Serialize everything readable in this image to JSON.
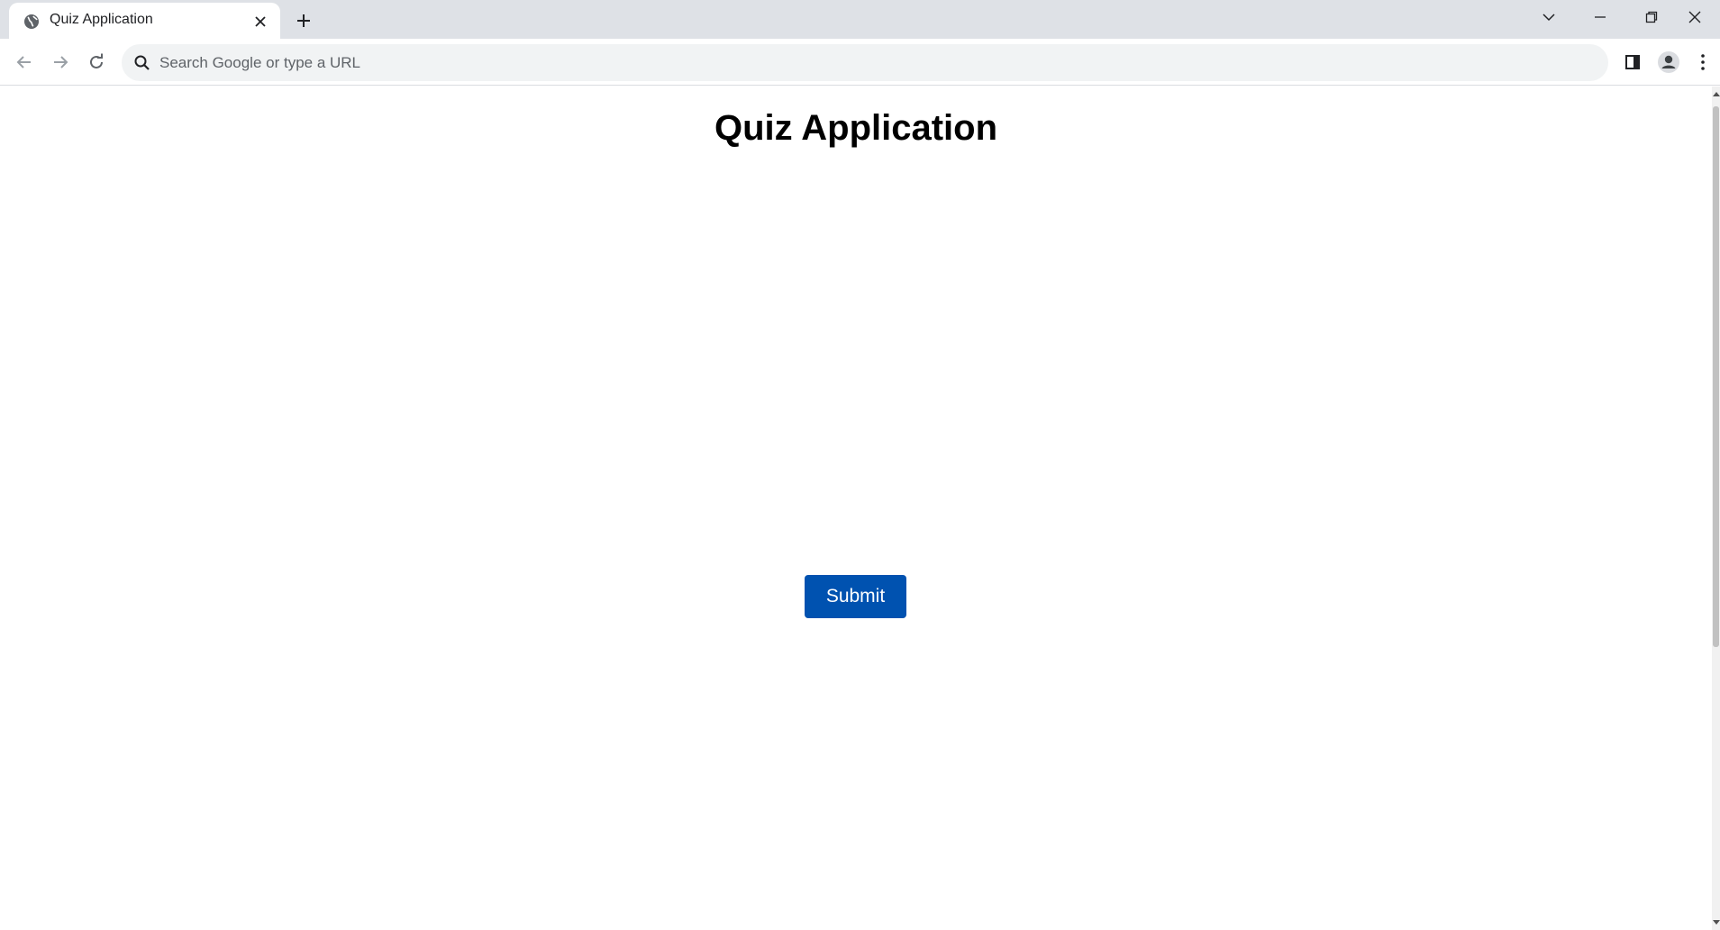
{
  "browser": {
    "tab": {
      "title": "Quiz Application"
    },
    "omnibox": {
      "placeholder": "Search Google or type a URL",
      "value": ""
    }
  },
  "page": {
    "title": "Quiz Application",
    "submit_label": "Submit"
  },
  "colors": {
    "tabstrip": "#dee1e6",
    "submit_button": "#0052b0",
    "omnibox_bg": "#f1f3f4"
  },
  "icons": {
    "tab": [
      "globe-icon",
      "close-icon",
      "plus-icon"
    ],
    "window": [
      "chevron-down-icon",
      "minimize-icon",
      "restore-icon",
      "close-window-icon"
    ],
    "toolbar": [
      "back-arrow-icon",
      "forward-arrow-icon",
      "reload-icon",
      "search-icon",
      "side-panel-icon",
      "profile-icon",
      "kebab-menu-icon"
    ]
  }
}
